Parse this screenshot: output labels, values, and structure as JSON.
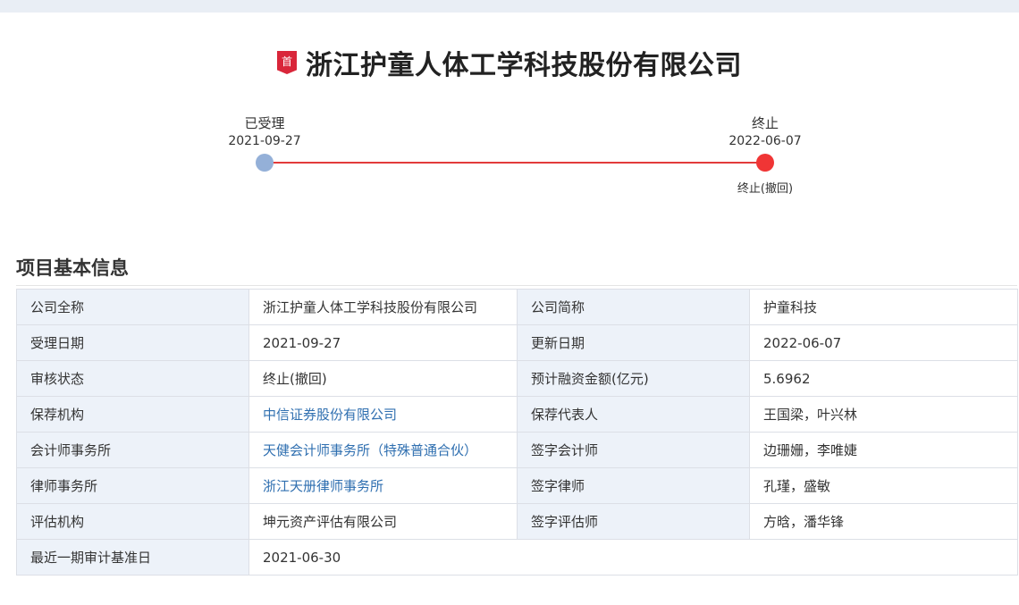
{
  "header": {
    "badge": "首",
    "company_name": "浙江护童人体工学科技股份有限公司"
  },
  "timeline": {
    "start": {
      "label": "已受理",
      "date": "2021-09-27"
    },
    "end": {
      "label": "终止",
      "date": "2022-06-07",
      "status": "终止(撤回)"
    },
    "colors": {
      "line": "#e23a3a",
      "start_dot": "#94b0d8",
      "end_dot": "#f03535"
    }
  },
  "section": {
    "title": "项目基本信息"
  },
  "info": {
    "company_full_name": {
      "label": "公司全称",
      "value": "浙江护童人体工学科技股份有限公司"
    },
    "company_short_name": {
      "label": "公司简称",
      "value": "护童科技"
    },
    "accept_date": {
      "label": "受理日期",
      "value": "2021-09-27"
    },
    "update_date": {
      "label": "更新日期",
      "value": "2022-06-07"
    },
    "review_status": {
      "label": "审核状态",
      "value": "终止(撤回)"
    },
    "planned_financing": {
      "label": "预计融资金额(亿元)",
      "value": "5.6962"
    },
    "sponsor": {
      "label": "保荐机构",
      "value": "中信证券股份有限公司"
    },
    "sponsor_reps": {
      "label": "保荐代表人",
      "value": "王国梁，叶兴林"
    },
    "accounting_firm": {
      "label": "会计师事务所",
      "value": "天健会计师事务所（特殊普通合伙）"
    },
    "signing_accountants": {
      "label": "签字会计师",
      "value": "边珊姗，李唯婕"
    },
    "law_firm": {
      "label": "律师事务所",
      "value": "浙江天册律师事务所"
    },
    "signing_lawyers": {
      "label": "签字律师",
      "value": "孔瑾，盛敏"
    },
    "appraisal_firm": {
      "label": "评估机构",
      "value": "坤元资产评估有限公司"
    },
    "signing_appraisers": {
      "label": "签字评估师",
      "value": "方晗，潘华锋"
    },
    "audit_base_date": {
      "label": "最近一期审计基准日",
      "value": "2021-06-30"
    }
  },
  "colors": {
    "link": "#2f6fb0",
    "label_bg": "#edf2f9",
    "badge": "#d9263a"
  }
}
